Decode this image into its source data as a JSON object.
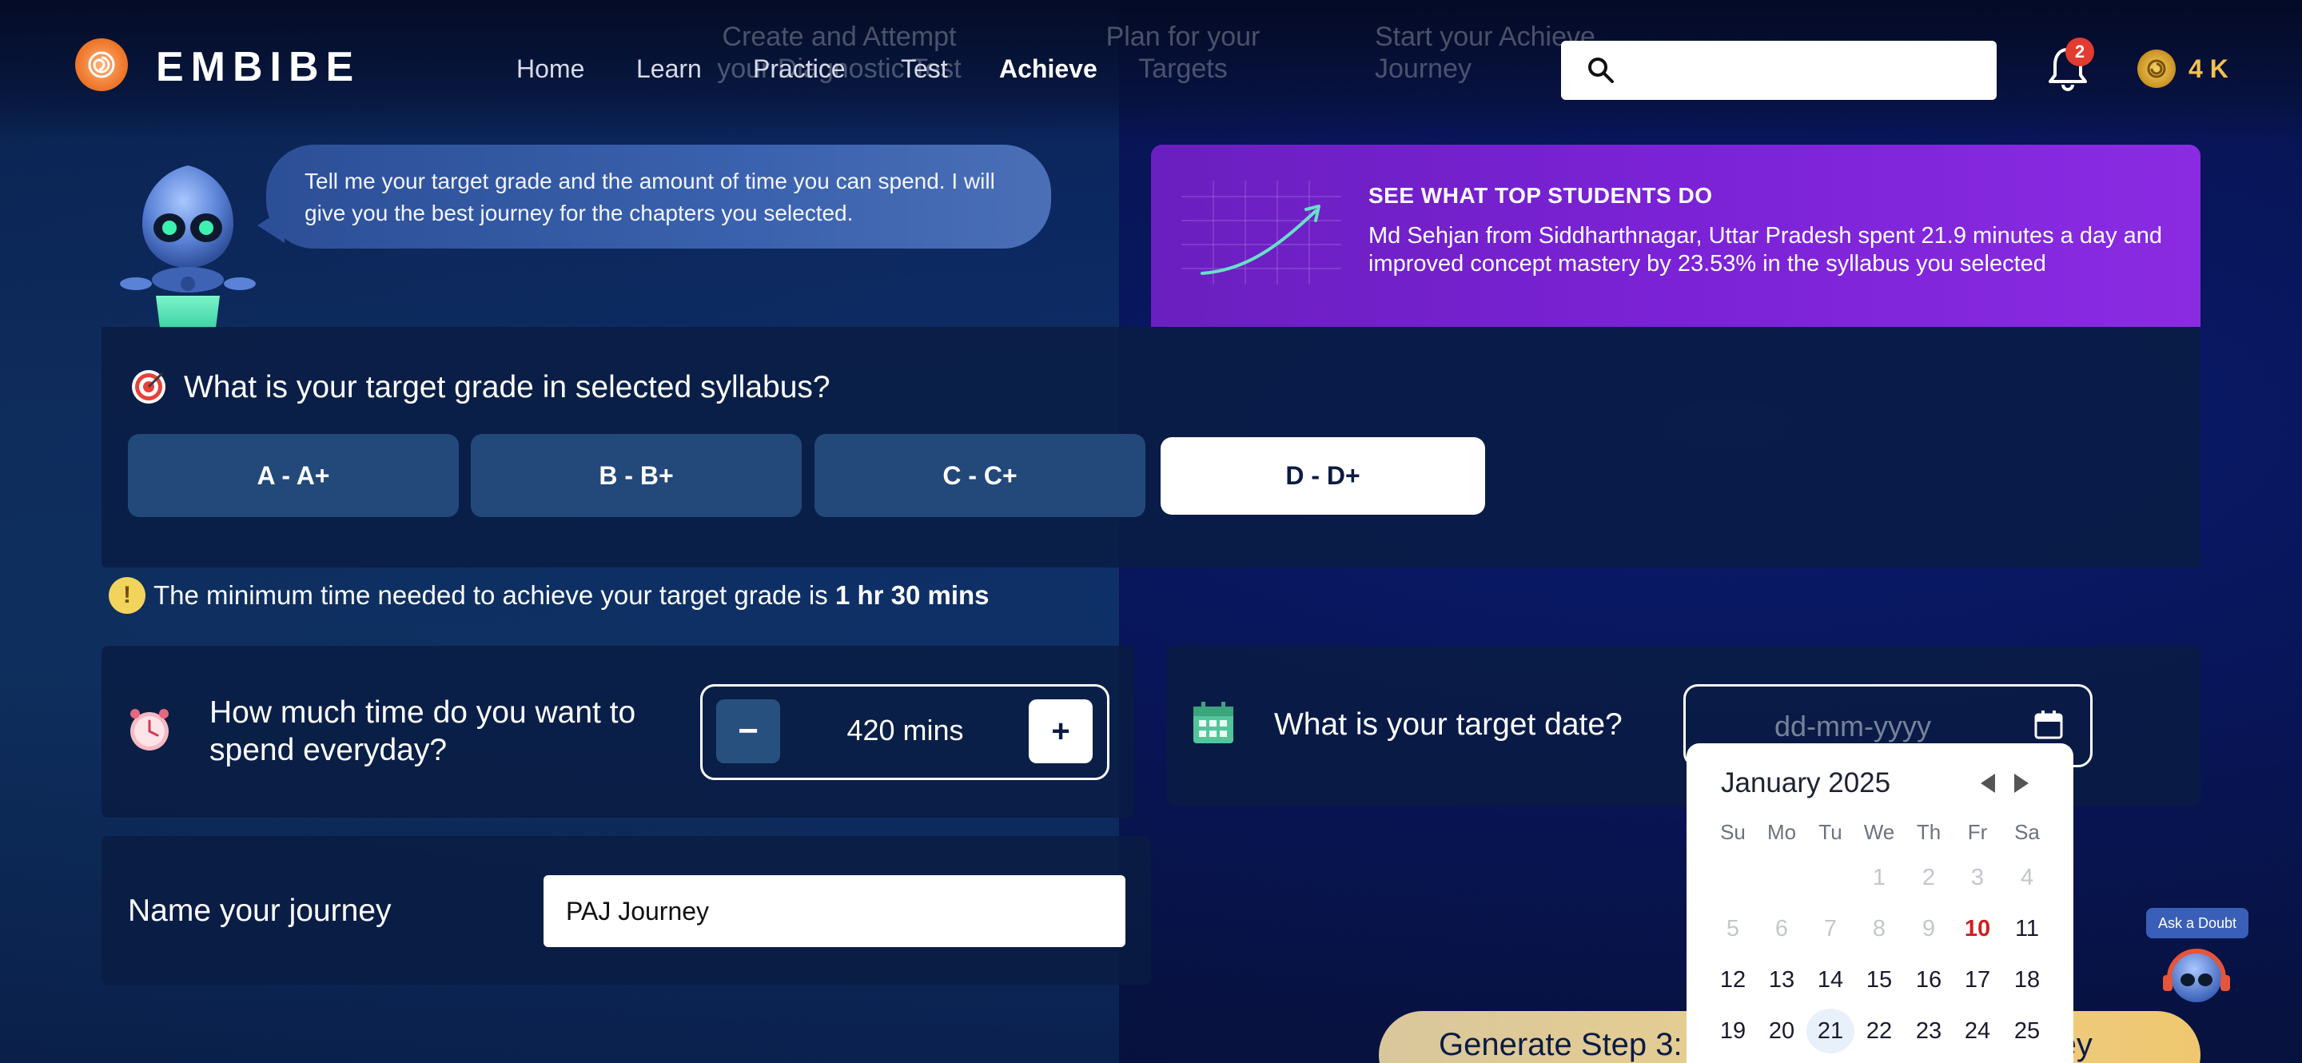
{
  "app": {
    "brand": "EMBIBE"
  },
  "header_ghost": {
    "step1": "Create and Attempt your Diagnostic Test",
    "step2": "Plan for your Targets",
    "step3": "Start your Achieve Journey"
  },
  "nav": {
    "items": [
      {
        "label": "Home"
      },
      {
        "label": "Learn"
      },
      {
        "label": "Practice"
      },
      {
        "label": "Test"
      },
      {
        "label": "Achieve"
      }
    ],
    "active": "Achieve"
  },
  "search": {
    "placeholder": ""
  },
  "notifications": {
    "count": "2"
  },
  "coins": {
    "value": "4 K"
  },
  "bot": {
    "message": "Tell me your target grade and the amount of time you can spend. I will give you the best journey for the chapters you selected."
  },
  "promo": {
    "title": "SEE WHAT TOP STUDENTS DO",
    "body": "Md Sehjan from Siddharthnagar, Uttar Pradesh spent 21.9 minutes a day and improved concept mastery by 23.53% in the syllabus you selected"
  },
  "grade": {
    "question": "What is your target grade in selected syllabus?",
    "options": [
      {
        "label": "A - A+"
      },
      {
        "label": "B - B+"
      },
      {
        "label": "C - C+"
      },
      {
        "label": "D - D+"
      }
    ],
    "selected": "D - D+"
  },
  "min_time": {
    "prefix": "The minimum time needed to achieve your target grade is",
    "value": "1 hr 30 mins"
  },
  "time_per_day": {
    "question": "How much time do you want to spend everyday?",
    "minus": "−",
    "plus": "+",
    "value": "420 mins"
  },
  "target_date": {
    "question": "What is your target date?",
    "placeholder": "dd-mm-yyyy"
  },
  "journey": {
    "label": "Name your journey",
    "value": "PAJ Journey"
  },
  "generate": {
    "left": "Generate Step 3:",
    "right": "rney"
  },
  "calendar": {
    "month": "January 2025",
    "weekdays": [
      "Su",
      "Mo",
      "Tu",
      "We",
      "Th",
      "Fr",
      "Sa"
    ],
    "rows": [
      [
        "",
        "",
        "",
        "1",
        "2",
        "3",
        "4"
      ],
      [
        "5",
        "6",
        "7",
        "8",
        "9",
        "10",
        "11"
      ],
      [
        "12",
        "13",
        "14",
        "15",
        "16",
        "17",
        "18"
      ],
      [
        "19",
        "20",
        "21",
        "22",
        "23",
        "24",
        "25"
      ]
    ],
    "today": "10",
    "highlighted": "21"
  },
  "ask_doubt": {
    "label": "Ask a Doubt"
  },
  "colors": {
    "accent_purple": "#7b22d6",
    "selected_grade_bg": "#ffffff",
    "grade_btn_bg": "#23487a",
    "today_red": "#d01f1f",
    "coin_gold": "#f2c14e"
  }
}
